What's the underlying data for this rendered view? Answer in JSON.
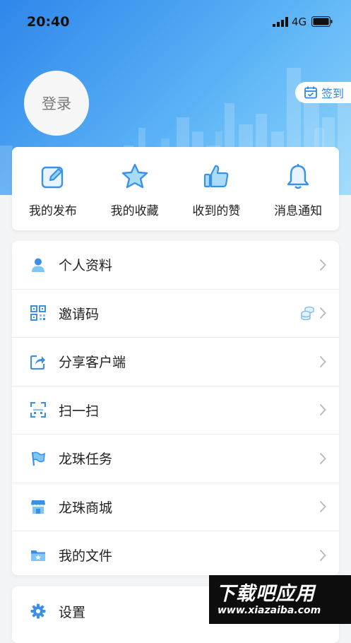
{
  "status_bar": {
    "time": "20:40",
    "network": "4G"
  },
  "profile": {
    "login_label": "登录",
    "checkin_label": "签到"
  },
  "quick_actions": [
    {
      "label": "我的发布",
      "icon": "edit-icon"
    },
    {
      "label": "我的收藏",
      "icon": "star-icon"
    },
    {
      "label": "收到的赞",
      "icon": "thumbs-up-icon"
    },
    {
      "label": "消息通知",
      "icon": "bell-icon"
    }
  ],
  "menu": [
    {
      "label": "个人资料",
      "icon": "person-icon"
    },
    {
      "label": "邀请码",
      "icon": "qr-code-icon",
      "badge_icon": "coins-icon"
    },
    {
      "label": "分享客户端",
      "icon": "share-icon"
    },
    {
      "label": "扫一扫",
      "icon": "scan-icon"
    },
    {
      "label": "龙珠任务",
      "icon": "flag-icon"
    },
    {
      "label": "龙珠商城",
      "icon": "store-icon"
    },
    {
      "label": "我的文件",
      "icon": "folder-icon"
    }
  ],
  "menu_secondary": [
    {
      "label": "设置",
      "icon": "gear-icon"
    }
  ],
  "watermark": {
    "title": "下载吧应用",
    "url": "www.xiazaiba.com"
  },
  "colors": {
    "accent": "#2e86e8",
    "header_start": "#2f86ea",
    "header_end": "#8fd5fb"
  }
}
